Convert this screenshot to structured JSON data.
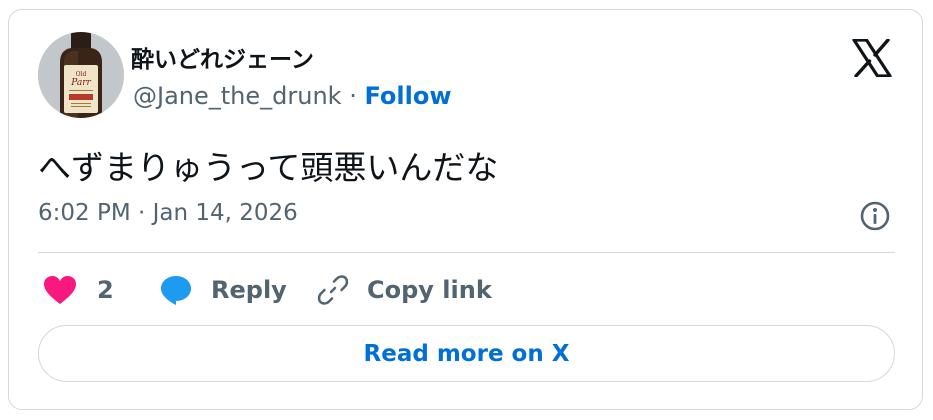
{
  "user": {
    "display_name": "酔いどれジェーン",
    "handle": "@Jane_the_drunk",
    "separator": "·",
    "follow_label": "Follow"
  },
  "tweet": {
    "text": "へずまりゅうって頭悪いんだな",
    "timestamp": "6:02 PM · Jan 14, 2026"
  },
  "actions": {
    "like_count": "2",
    "reply_label": "Reply",
    "copy_link_label": "Copy link"
  },
  "read_more_label": "Read more on X",
  "icons": {
    "brand": "x-logo-icon",
    "info": "info-icon",
    "like": "heart-icon",
    "reply": "speech-bubble-icon",
    "copy": "link-icon"
  },
  "colors": {
    "link_blue": "#006fd6",
    "like_pink": "#f91880",
    "reply_blue": "#1d9bf0",
    "secondary_text": "#536471",
    "border": "#cfd9de"
  }
}
